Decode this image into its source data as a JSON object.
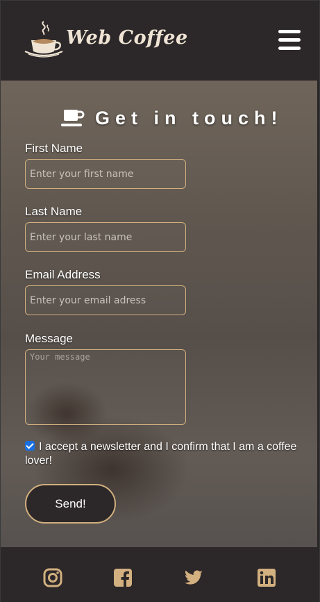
{
  "brand": {
    "name": "Web Coffee",
    "logo_icon": "coffee-cup-logo",
    "accent": "#d2b07f"
  },
  "header": {
    "menu_icon": "hamburger-menu-icon"
  },
  "form": {
    "title": "Get in touch!",
    "title_icon": "mug-icon",
    "first_name": {
      "label": "First Name",
      "placeholder": "Enter your first name",
      "value": ""
    },
    "last_name": {
      "label": "Last Name",
      "placeholder": "Enter your last name",
      "value": ""
    },
    "email": {
      "label": "Email Address",
      "placeholder": "Enter your email adress",
      "value": ""
    },
    "message": {
      "label": "Message",
      "placeholder": "Your message",
      "value": ""
    },
    "consent": {
      "checked": true,
      "text": "I accept a newsletter and I confirm that I am a coffee lover!"
    },
    "submit_label": "Send!"
  },
  "footer": {
    "social": [
      "instagram-icon",
      "facebook-icon",
      "twitter-icon",
      "linkedin-icon"
    ]
  }
}
